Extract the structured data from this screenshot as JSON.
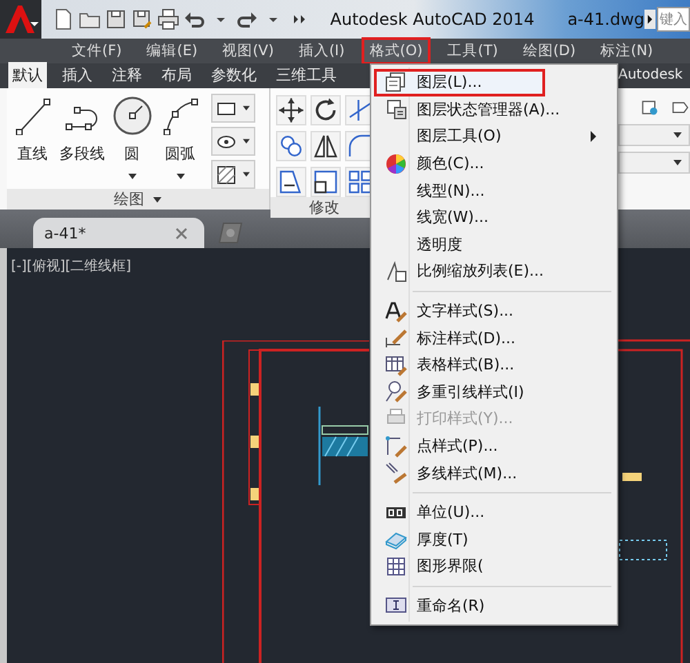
{
  "title_bar": {
    "title": "Autodesk AutoCAD 2014",
    "file": "a-41.dwg",
    "search": {
      "placeholder": "键入"
    }
  },
  "menu_bar": [
    {
      "label": "文件(F)",
      "selected": false
    },
    {
      "label": "编辑(E)",
      "selected": false
    },
    {
      "label": "视图(V)",
      "selected": false
    },
    {
      "label": "插入(I)",
      "selected": false
    },
    {
      "label": "格式(O)",
      "selected": true
    },
    {
      "label": "工具(T)",
      "selected": false
    },
    {
      "label": "绘图(D)",
      "selected": false
    },
    {
      "label": "标注(N)",
      "selected": false
    }
  ],
  "ribbon_tabs": [
    {
      "label": "默认",
      "selected": true
    },
    {
      "label": "插入",
      "selected": false
    },
    {
      "label": "注释",
      "selected": false
    },
    {
      "label": "布局",
      "selected": false
    },
    {
      "label": "参数化",
      "selected": false
    },
    {
      "label": "三维工具",
      "selected": false
    }
  ],
  "ribbon_brand": "Autodesk",
  "ribbon_tools": [
    {
      "label": "直线",
      "dropdown": false
    },
    {
      "label": "多段线",
      "dropdown": false
    },
    {
      "label": "圆",
      "dropdown": true
    },
    {
      "label": "圆弧",
      "dropdown": true
    }
  ],
  "panels": [
    {
      "label": "绘图"
    },
    {
      "label": "修改"
    }
  ],
  "document_tabs": [
    {
      "label": "a-41*",
      "selected": true
    }
  ],
  "viewport_label": "[-][俯视][二维线框]",
  "menu": [
    {
      "kind": "item",
      "label": "图层(L)...",
      "highlighted": true,
      "disabled": false,
      "submenu": false
    },
    {
      "kind": "item",
      "label": "图层状态管理器(A)...",
      "highlighted": false,
      "disabled": false,
      "submenu": false
    },
    {
      "kind": "item",
      "label": "图层工具(O)",
      "highlighted": false,
      "disabled": false,
      "submenu": true
    },
    {
      "kind": "item",
      "label": "颜色(C)...",
      "highlighted": false,
      "disabled": false,
      "submenu": false
    },
    {
      "kind": "item",
      "label": "线型(N)...",
      "highlighted": false,
      "disabled": false,
      "submenu": false
    },
    {
      "kind": "item",
      "label": "线宽(W)...",
      "highlighted": false,
      "disabled": false,
      "submenu": false
    },
    {
      "kind": "item",
      "label": "透明度",
      "highlighted": false,
      "disabled": false,
      "submenu": false
    },
    {
      "kind": "item",
      "label": "比例缩放列表(E)...",
      "highlighted": false,
      "disabled": false,
      "submenu": false
    },
    {
      "kind": "separator"
    },
    {
      "kind": "item",
      "label": "文字样式(S)...",
      "highlighted": false,
      "disabled": false,
      "submenu": false
    },
    {
      "kind": "item",
      "label": "标注样式(D)...",
      "highlighted": false,
      "disabled": false,
      "submenu": false
    },
    {
      "kind": "item",
      "label": "表格样式(B)...",
      "highlighted": false,
      "disabled": false,
      "submenu": false
    },
    {
      "kind": "item",
      "label": "多重引线样式(I)",
      "highlighted": false,
      "disabled": false,
      "submenu": false
    },
    {
      "kind": "item",
      "label": "打印样式(Y)...",
      "highlighted": false,
      "disabled": true,
      "submenu": false
    },
    {
      "kind": "item",
      "label": "点样式(P)...",
      "highlighted": false,
      "disabled": false,
      "submenu": false
    },
    {
      "kind": "item",
      "label": "多线样式(M)...",
      "highlighted": false,
      "disabled": false,
      "submenu": false
    },
    {
      "kind": "separator"
    },
    {
      "kind": "item",
      "label": "单位(U)...",
      "highlighted": false,
      "disabled": false,
      "submenu": false
    },
    {
      "kind": "item",
      "label": "厚度(T)",
      "highlighted": false,
      "disabled": false,
      "submenu": false
    },
    {
      "kind": "item",
      "label": "图形界限(",
      "highlighted": false,
      "disabled": false,
      "submenu": false
    },
    {
      "kind": "separator"
    },
    {
      "kind": "item",
      "label": "重命名(R)",
      "highlighted": false,
      "disabled": false,
      "submenu": false
    }
  ]
}
